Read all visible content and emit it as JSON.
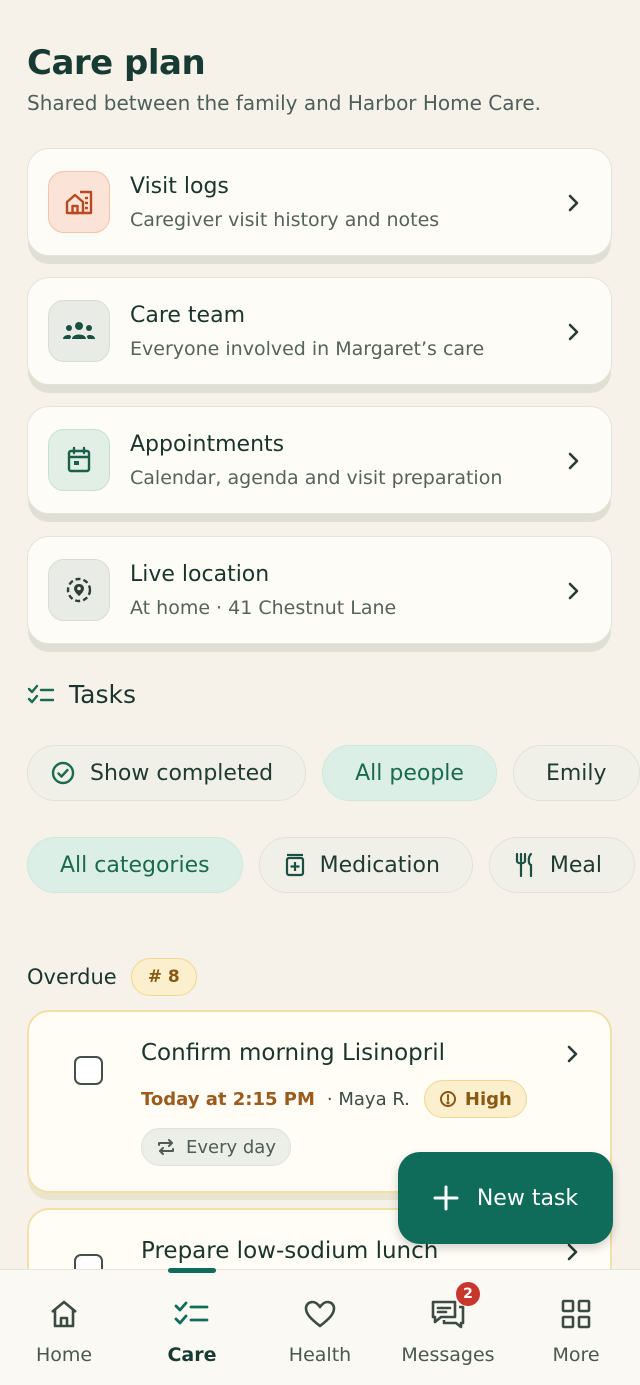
{
  "header": {
    "title": "Care plan",
    "subtitle": "Shared between the family and Harbor Home Care."
  },
  "cards": [
    {
      "title": "Visit logs",
      "subtitle": "Caregiver visit history and notes",
      "icon": "house-log-icon"
    },
    {
      "title": "Care team",
      "subtitle": "Everyone involved in Margaret’s care",
      "icon": "team-icon"
    },
    {
      "title": "Appointments",
      "subtitle": "Calendar, agenda and visit preparation",
      "icon": "calendar-icon"
    },
    {
      "title": "Live location",
      "subtitle": "At home · 41 Chestnut Lane",
      "icon": "location-icon"
    }
  ],
  "tasks": {
    "heading": "Tasks",
    "people_filters": [
      "Show completed",
      "All people",
      "Emily"
    ],
    "category_filters": [
      "All categories",
      "Medication",
      "Meal"
    ],
    "overdue_label": "Overdue",
    "overdue_count": "# 8",
    "items": [
      {
        "title": "Confirm morning Lisinopril",
        "due": "Today at 2:15 PM",
        "assignee": "· Maya R.",
        "priority": "High",
        "repeat": "Every day"
      },
      {
        "title": "Prepare low-sodium lunch"
      }
    ]
  },
  "fab": {
    "label": "New task"
  },
  "nav": {
    "items": [
      {
        "label": "Home"
      },
      {
        "label": "Care"
      },
      {
        "label": "Health"
      },
      {
        "label": "Messages",
        "badge": "2"
      },
      {
        "label": "More"
      }
    ]
  },
  "colors": {
    "accent": "#0f6b5a",
    "background": "#f6f2ea",
    "warning": "#9a5b1d",
    "badge": "#c8372d"
  }
}
